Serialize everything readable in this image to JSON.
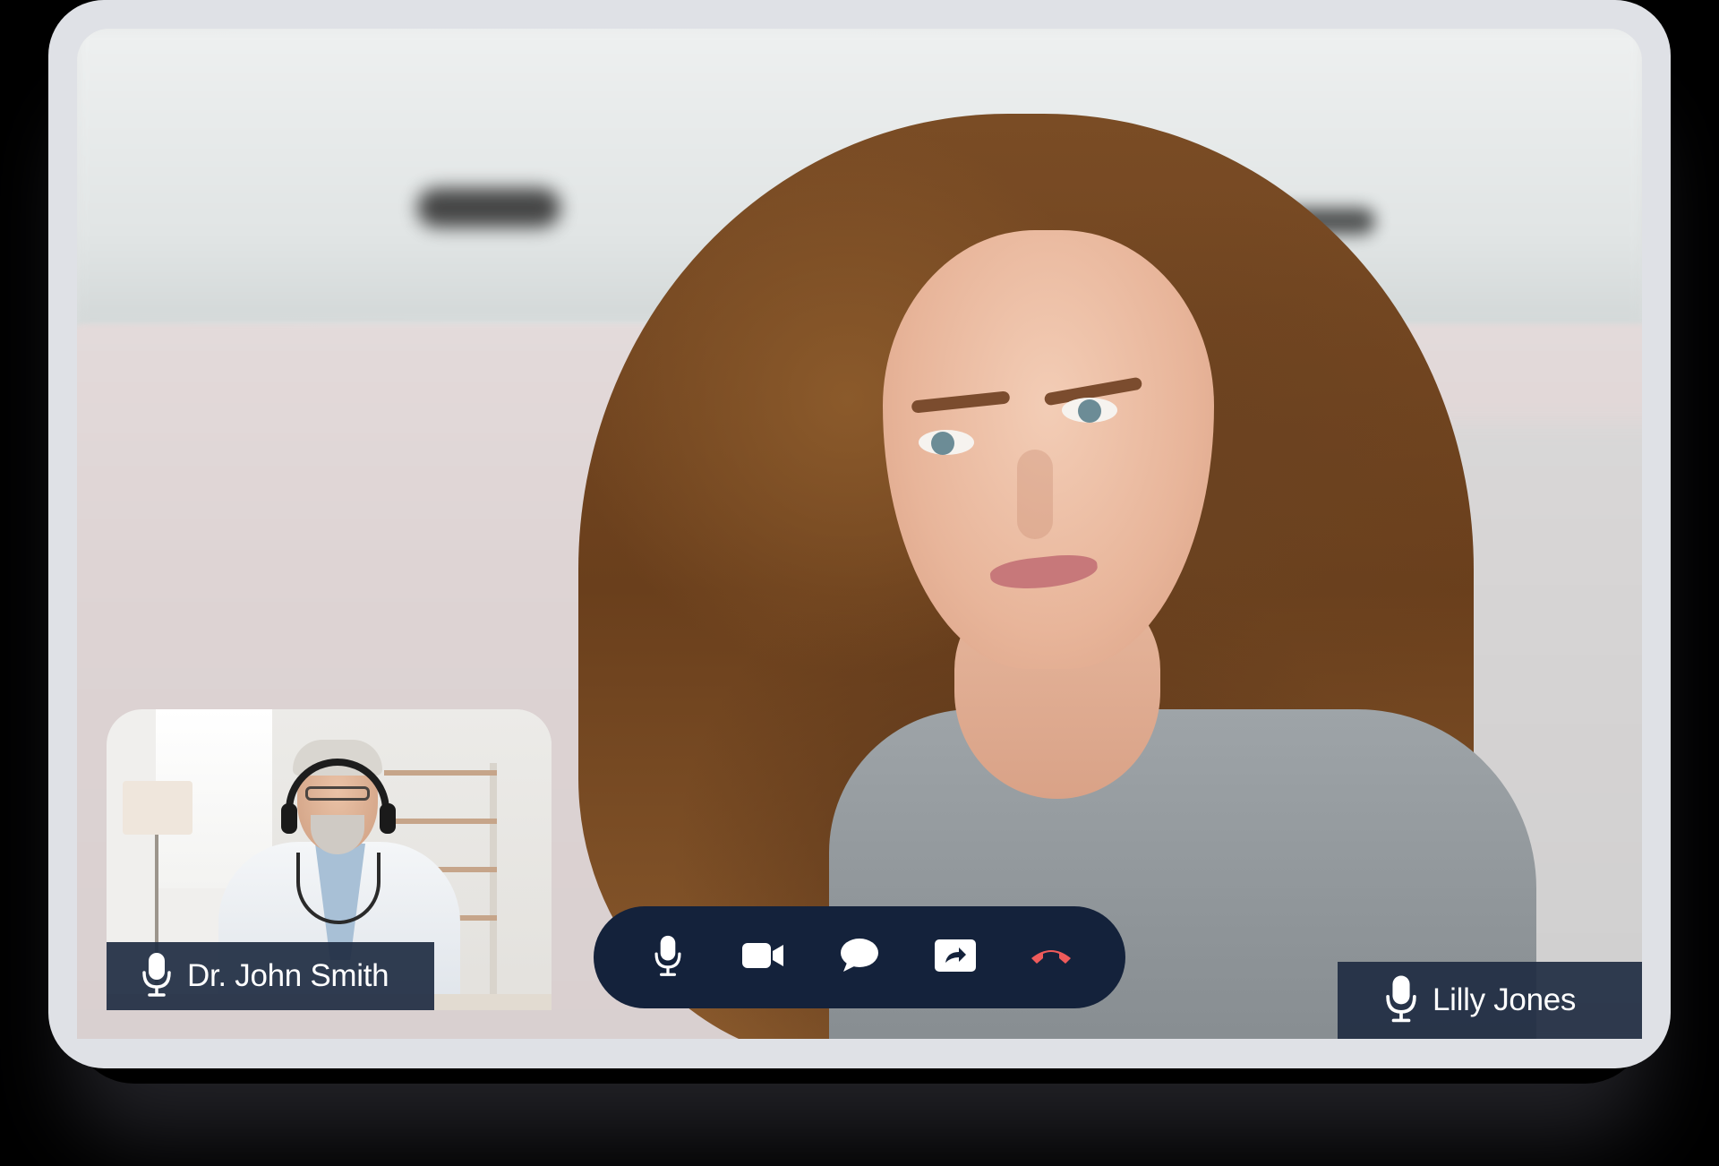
{
  "call": {
    "local_participant": {
      "name": "Dr. John Smith",
      "mic_icon": "microphone-icon"
    },
    "remote_participant": {
      "name": "Lilly Jones",
      "mic_icon": "microphone-icon"
    }
  },
  "controls": [
    {
      "id": "mute",
      "icon": "microphone-icon"
    },
    {
      "id": "camera",
      "icon": "video-camera-icon"
    },
    {
      "id": "chat",
      "icon": "chat-bubble-icon"
    },
    {
      "id": "share",
      "icon": "share-screen-icon"
    },
    {
      "id": "end-call",
      "icon": "hang-up-icon",
      "color": "#ef5b5b"
    }
  ],
  "colors": {
    "control_bar_bg": "#14223b",
    "name_tag_bg": "#202c42",
    "hangup_red": "#ef5b5b",
    "frame": "#dfe1e6"
  }
}
